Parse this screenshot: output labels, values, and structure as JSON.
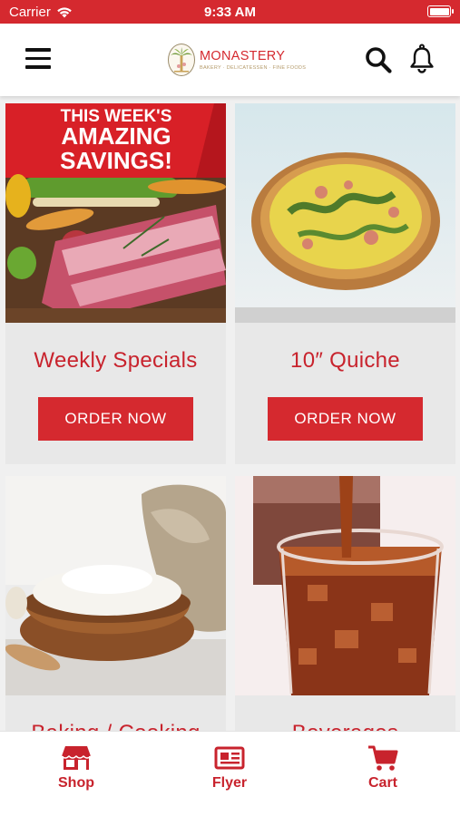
{
  "status_bar": {
    "carrier": "Carrier",
    "time": "9:33 AM",
    "battery_level": 0.9
  },
  "header": {
    "menu_icon": "hamburger-menu-icon",
    "logo": {
      "name": "MONASTERY",
      "tagline": "BAKERY · DELICATESSEN · FINE FOODS"
    },
    "search_icon": "search-icon",
    "notifications_icon": "bell-icon"
  },
  "cards": [
    {
      "title": "Weekly Specials",
      "button": "ORDER NOW",
      "banner": {
        "line1": "THIS WEEK'S",
        "line2": "AMAZING",
        "line3": "SAVINGS!"
      }
    },
    {
      "title": "10″ Quiche",
      "button": "ORDER NOW"
    },
    {
      "title": "Baking / Cooking"
    },
    {
      "title": "Beverages"
    }
  ],
  "tab_bar": {
    "items": [
      {
        "label": "Shop",
        "icon": "storefront-icon"
      },
      {
        "label": "Flyer",
        "icon": "newspaper-icon"
      },
      {
        "label": "Cart",
        "icon": "cart-icon"
      }
    ]
  },
  "colors": {
    "brand_red": "#d5292f",
    "card_bg": "#e8e8e8"
  }
}
